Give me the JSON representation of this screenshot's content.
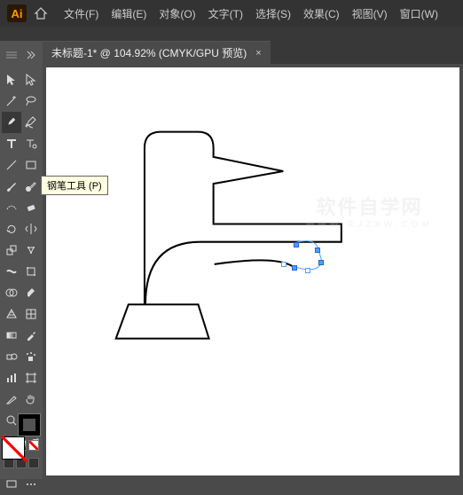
{
  "app": {
    "logo": "Ai"
  },
  "menu": {
    "file": "文件(F)",
    "edit": "编辑(E)",
    "object": "对象(O)",
    "type": "文字(T)",
    "select": "选择(S)",
    "effect": "效果(C)",
    "view": "视图(V)",
    "window": "窗口(W)"
  },
  "tab": {
    "title": "未标题-1* @ 104.92% (CMYK/GPU 预览)",
    "close": "×"
  },
  "tooltip": {
    "pen": "钢笔工具 (P)"
  },
  "watermark": {
    "main": "软件自学网",
    "sub": "WWW.RJZXW.COM"
  },
  "tools": {
    "selection": "selection",
    "direct": "direct-selection",
    "magicwand": "magic-wand",
    "lasso": "lasso",
    "pen": "pen",
    "curvature": "curvature",
    "type": "type",
    "touchtype": "touch-type",
    "line": "line",
    "rect": "rectangle",
    "brush": "brush",
    "blob": "blob-brush",
    "shaper": "shaper",
    "eraser": "eraser",
    "rotate": "rotate",
    "mirror": "mirror",
    "scale": "scale",
    "puppet": "puppet",
    "width": "width",
    "freetrans": "free-transform",
    "shapebuild": "shape-builder",
    "livepaint": "live-paint",
    "perspective": "perspective",
    "mesh": "mesh",
    "gradient": "gradient",
    "eyedrop": "eyedropper",
    "blend": "blend",
    "symbol": "symbol-sprayer",
    "graph": "column-graph",
    "artboard": "artboard",
    "slice": "slice",
    "hand": "hand",
    "zoom": "zoom"
  }
}
